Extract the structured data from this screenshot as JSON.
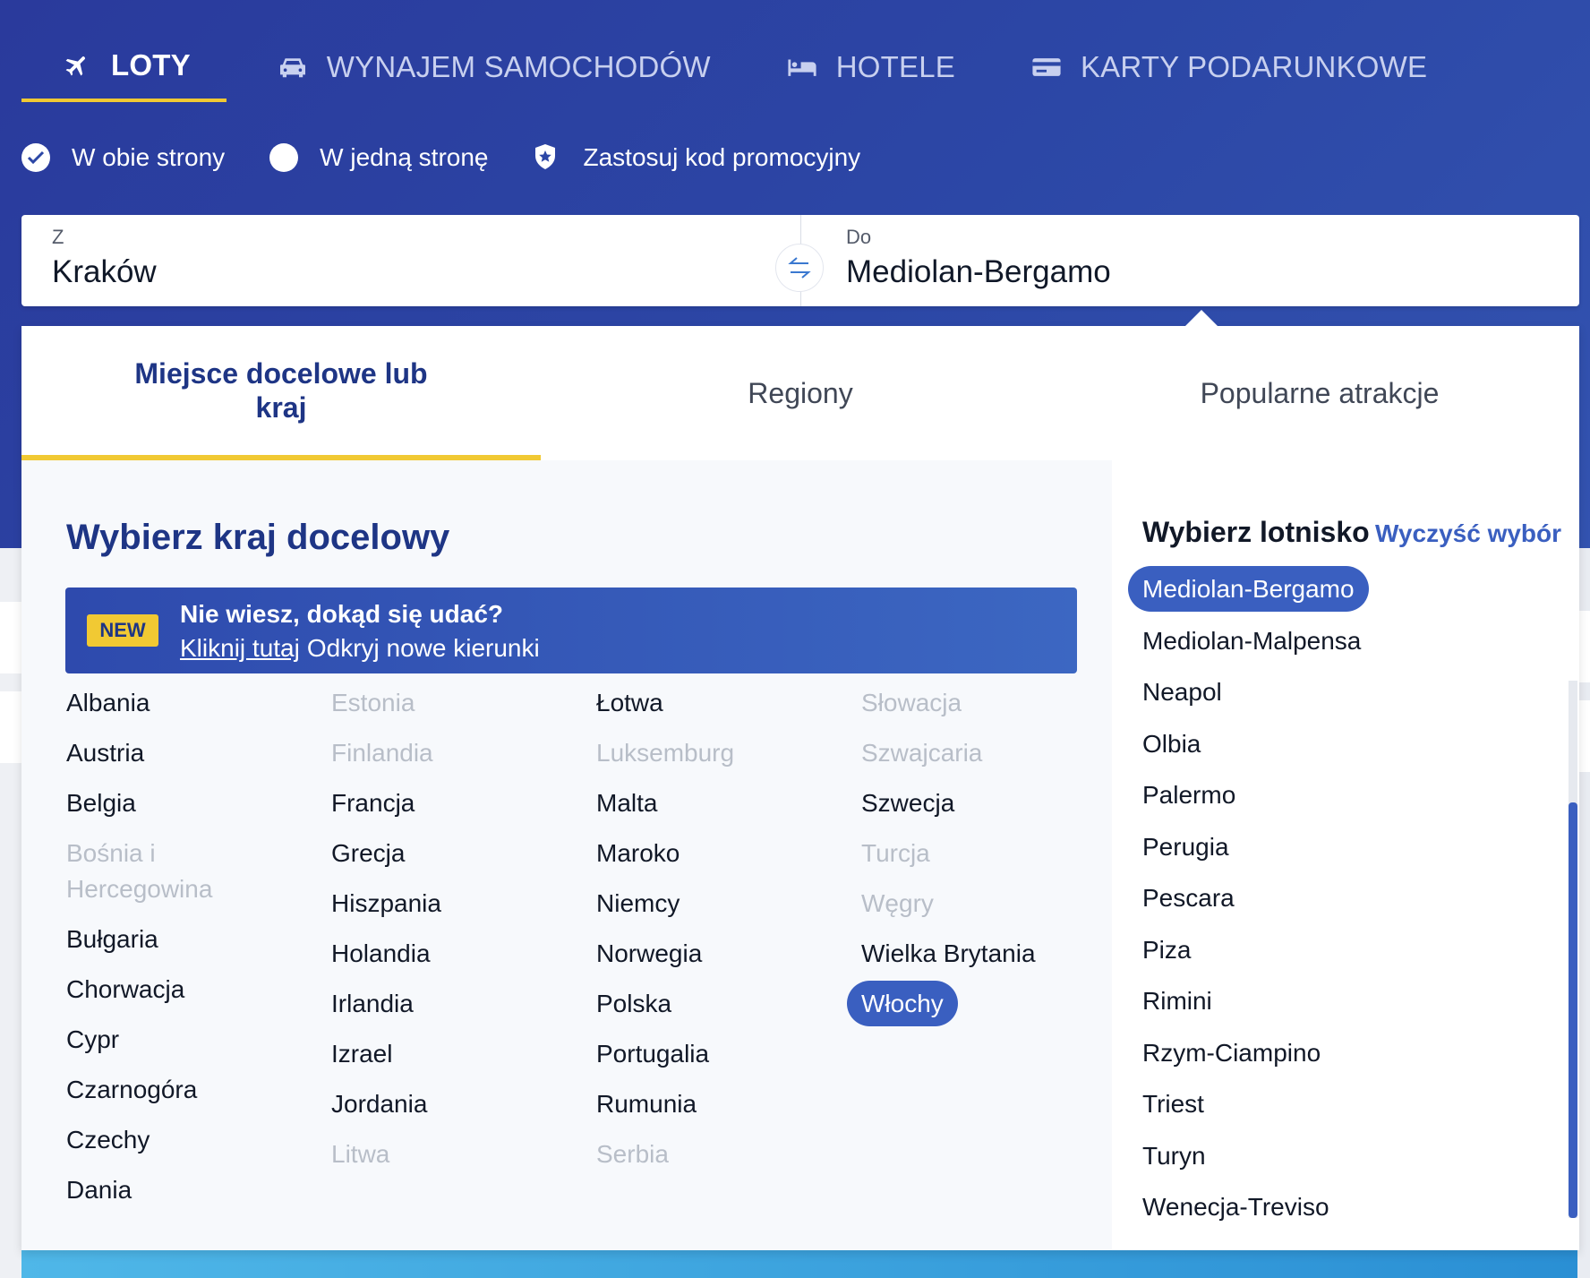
{
  "nav": {
    "tabs": [
      {
        "label": "LOTY",
        "icon": "airplane-icon"
      },
      {
        "label": "WYNAJEM SAMOCHODÓW",
        "icon": "car-icon"
      },
      {
        "label": "HOTELE",
        "icon": "bed-icon"
      },
      {
        "label": "KARTY PODARUNKOWE",
        "icon": "gift-card-icon"
      }
    ]
  },
  "trip": {
    "round_trip": "W obie strony",
    "one_way": "W jedną stronę",
    "promo": "Zastosuj kod promocyjny"
  },
  "search": {
    "from_label": "Z",
    "from_value": "Kraków",
    "to_label": "Do",
    "to_value": "Mediolan-Bergamo"
  },
  "panel": {
    "tabs": [
      "Miejsce docelowe lub kraj",
      "Regiony",
      "Popularne atrakcje"
    ],
    "heading": "Wybierz kraj docelowy",
    "banner": {
      "badge": "NEW",
      "title": "Nie wiesz, dokąd się udać?",
      "link": "Kliknij tutaj",
      "text": "Odkryj nowe kierunki"
    },
    "countries": [
      [
        "Albania",
        "Austria",
        "Belgia",
        "Bośnia i Hercegowina",
        "Bułgaria",
        "Chorwacja",
        "Cypr",
        "Czarnogóra",
        "Czechy",
        "Dania"
      ],
      [
        "Estonia",
        "Finlandia",
        "Francja",
        "Grecja",
        "Hiszpania",
        "Holandia",
        "Irlandia",
        "Izrael",
        "Jordania",
        "Litwa"
      ],
      [
        "Łotwa",
        "Luksemburg",
        "Malta",
        "Maroko",
        "Niemcy",
        "Norwegia",
        "Polska",
        "Portugalia",
        "Rumunia",
        "Serbia"
      ],
      [
        "Słowacja",
        "Szwajcaria",
        "Szwecja",
        "Turcja",
        "Węgry",
        "Wielka Brytania",
        "Włochy"
      ]
    ],
    "airports_heading": "Wybierz lotnisko",
    "clear": "Wyczyść wybór",
    "airports": [
      "Mediolan-Bergamo",
      "Mediolan-Malpensa",
      "Neapol",
      "Olbia",
      "Palermo",
      "Perugia",
      "Pescara",
      "Piza",
      "Rimini",
      "Rzym-Ciampino",
      "Triest",
      "Turyn",
      "Wenecja-Treviso"
    ]
  },
  "colors": {
    "brand_blue": "#2a3a9c",
    "accent_yellow": "#f1c933",
    "selected": "#3a5fc0",
    "heading": "#1e3585"
  }
}
